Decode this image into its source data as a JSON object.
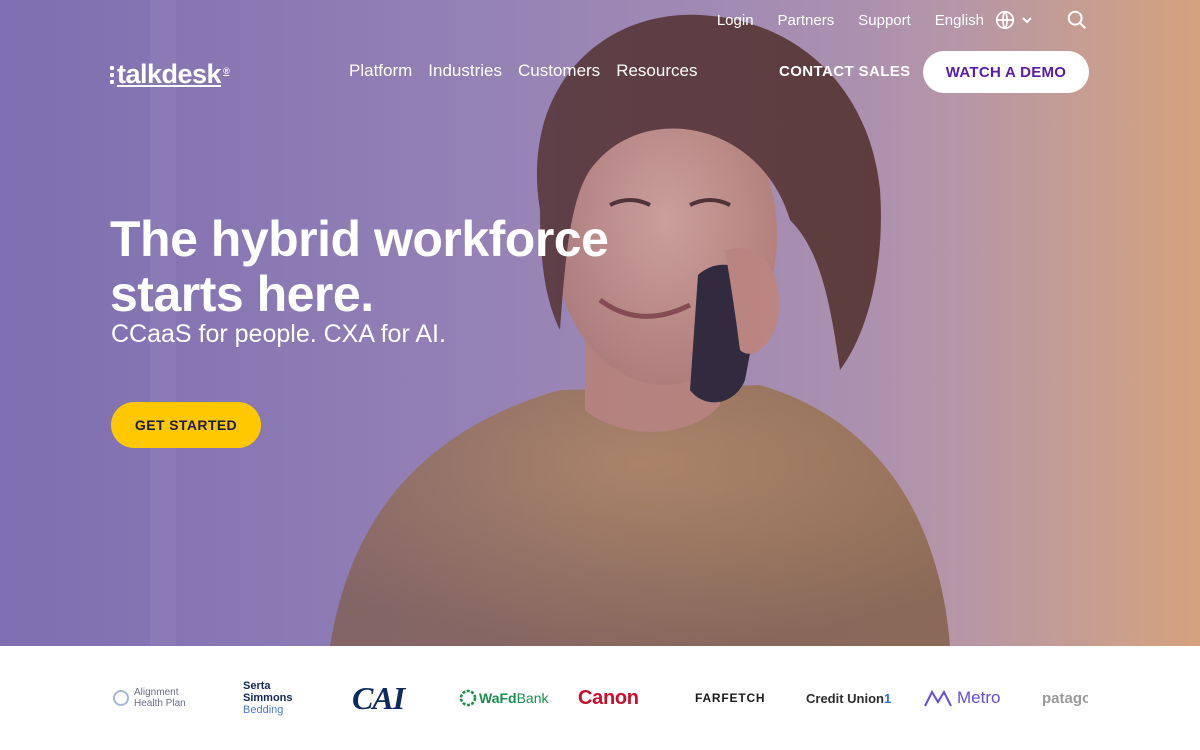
{
  "utility_nav": {
    "login": "Login",
    "partners": "Partners",
    "support": "Support",
    "language": "English"
  },
  "main_nav": {
    "logo_text": "talkdesk",
    "items": [
      "Platform",
      "Industries",
      "Customers",
      "Resources"
    ],
    "contact_sales": "CONTACT SALES",
    "watch_demo": "WATCH A DEMO"
  },
  "hero": {
    "headline": "The hybrid workforce starts here.",
    "subheadline": "CCaaS for people. CXA for AI.",
    "cta": "GET STARTED"
  },
  "customer_logos": {
    "alignment": [
      "Alignment",
      "Health Plan"
    ],
    "serta": [
      "Serta",
      "Simmons",
      "Bedding"
    ],
    "cai": "CAI",
    "wafd": "WaFd",
    "wafd_bank": "Bank",
    "canon": "Canon",
    "farfetch": "FARFETCH",
    "credit_union": "Credit Union",
    "credit_union_num": "1",
    "metro": "Metro",
    "patagonia": "patagonia"
  },
  "colors": {
    "cta_yellow": "#ffc800",
    "demo_text_purple": "#5a1ba8",
    "hero_tint": "#8d7fb5"
  },
  "icons": [
    "globe-icon",
    "chevron-down-icon",
    "search-icon"
  ]
}
